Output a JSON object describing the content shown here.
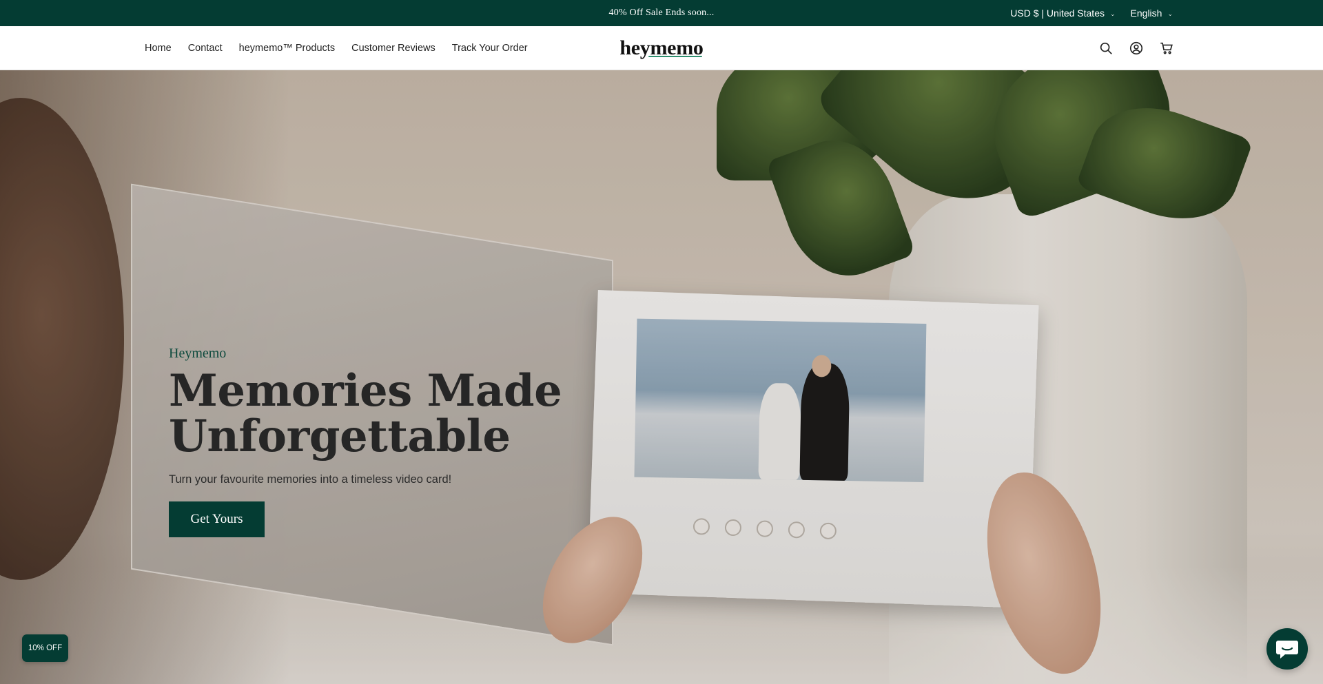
{
  "announcement": {
    "message": "40% Off Sale Ends soon...",
    "currency": "USD $ | United States",
    "language": "English"
  },
  "nav": {
    "items": [
      "Home",
      "Contact",
      "heymemo™ Products",
      "Customer Reviews",
      "Track Your Order"
    ]
  },
  "logo": {
    "text": "heymemo"
  },
  "header_icons": [
    "search-icon",
    "account-icon",
    "cart-icon"
  ],
  "hero": {
    "eyebrow": "Heymemo",
    "headline_line1": "Memories Made",
    "headline_line2": "Unforgettable",
    "subtext": "Turn your favourite memories into a timeless video card!",
    "cta_label": "Get Yours"
  },
  "discount_badge": {
    "label": "10% OFF"
  },
  "colors": {
    "brand_dark_green": "#043c33",
    "eyebrow_green": "#0d4a3d",
    "logo_underline": "#2e8f6f"
  }
}
